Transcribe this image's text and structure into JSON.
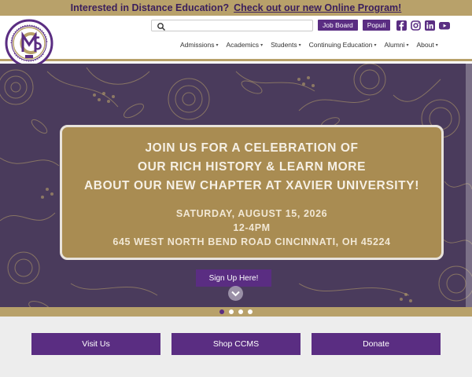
{
  "banner": {
    "text": "Interested in Distance Education?",
    "link": "Check out our new Online Program!"
  },
  "logo": {
    "name": "College of Mortuary Science Cincinnati",
    "initials": "CMS"
  },
  "utility": {
    "search_placeholder": "",
    "job_board": "Job Board",
    "populi": "Populi"
  },
  "social": [
    "facebook-icon",
    "instagram-icon",
    "linkedin-icon",
    "youtube-icon"
  ],
  "nav": [
    {
      "label": "Admissions"
    },
    {
      "label": "Academics"
    },
    {
      "label": "Students"
    },
    {
      "label": "Continuing Education"
    },
    {
      "label": "Alumni"
    },
    {
      "label": "About"
    }
  ],
  "hero": {
    "headline": [
      "JOIN US FOR A CELEBRATION OF",
      "OUR RICH HISTORY & LEARN MORE",
      "ABOUT OUR NEW CHAPTER AT XAVIER UNIVERSITY!"
    ],
    "date": "SATURDAY, AUGUST 15, 2026",
    "time": "12-4PM",
    "address": "645 WEST NORTH BEND ROAD CINCINNATI, OH 45224",
    "cta": "Sign Up Here!"
  },
  "slider": {
    "count": 4,
    "active_index": 0
  },
  "buttons": [
    "Visit Us",
    "Shop CCMS",
    "Donate"
  ],
  "colors": {
    "purple": "#5a2d82",
    "gold": "#b8a16a",
    "hero_bg": "#4a3b5c",
    "card_gold": "#a98c52"
  }
}
